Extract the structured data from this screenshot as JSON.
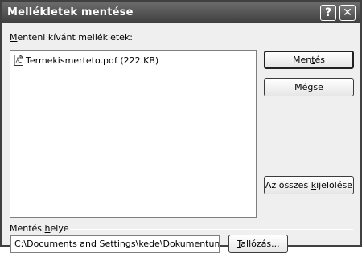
{
  "window": {
    "title": "Mellékletek mentése",
    "help_glyph": "?",
    "close_glyph": "✕"
  },
  "list_label_prefix": "M",
  "list_label_rest": "enteni kívánt mellékletek:",
  "attachments": [
    {
      "label": "Termekismerteto.pdf (222 KB)",
      "icon": "pdf-icon"
    }
  ],
  "buttons": {
    "save": {
      "pre": "Men",
      "u": "t",
      "post": "és"
    },
    "cancel": "Mégse",
    "select_all": {
      "pre": "Az összes ",
      "u": "k",
      "post": "ijelölése"
    },
    "browse": {
      "u": "T",
      "post": "allózás..."
    }
  },
  "save_location": {
    "label_pre": "Mentés ",
    "label_u": "h",
    "label_post": "elye",
    "path": "C:\\Documents and Settings\\kede\\Dokumentumok"
  }
}
